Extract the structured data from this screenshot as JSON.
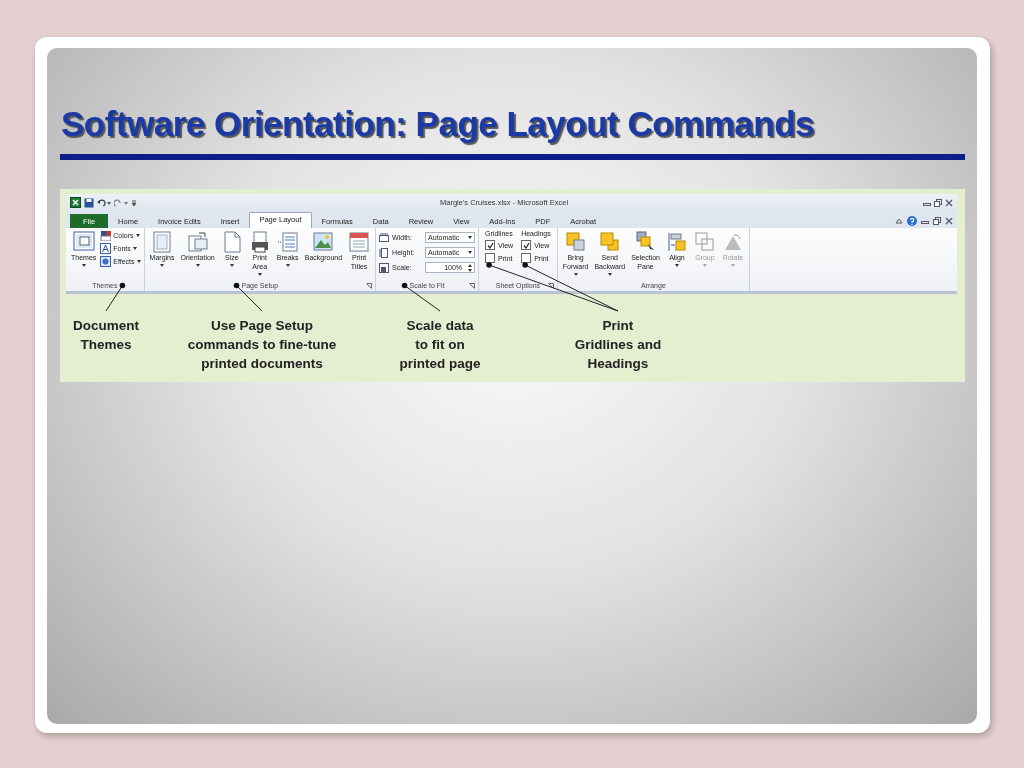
{
  "slide": {
    "title": "Software Orientation: Page Layout Commands"
  },
  "window": {
    "title": "Margie's Cruises.xlsx  -  Microsoft Excel"
  },
  "tabs": [
    {
      "label": "File",
      "selected": false,
      "kind": "file"
    },
    {
      "label": "Home",
      "selected": false,
      "kind": "tab"
    },
    {
      "label": "Invoice Edits",
      "selected": false,
      "kind": "tab"
    },
    {
      "label": "Insert",
      "selected": false,
      "kind": "tab"
    },
    {
      "label": "Page Layout",
      "selected": true,
      "kind": "tab"
    },
    {
      "label": "Formulas",
      "selected": false,
      "kind": "tab"
    },
    {
      "label": "Data",
      "selected": false,
      "kind": "tab"
    },
    {
      "label": "Review",
      "selected": false,
      "kind": "tab"
    },
    {
      "label": "View",
      "selected": false,
      "kind": "tab"
    },
    {
      "label": "Add-Ins",
      "selected": false,
      "kind": "tab"
    },
    {
      "label": "PDF",
      "selected": false,
      "kind": "tab"
    },
    {
      "label": "Acrobat",
      "selected": false,
      "kind": "tab"
    }
  ],
  "groups": [
    {
      "kind": "commands",
      "label": "Themes",
      "launcher": false,
      "commands": [
        {
          "kind": "large",
          "label": "Themes",
          "dropdown": true,
          "disabled": false
        },
        {
          "kind": "small",
          "label": "Colors",
          "dropdown": true,
          "disabled": false
        },
        {
          "kind": "small",
          "label": "Fonts",
          "dropdown": true,
          "disabled": false
        },
        {
          "kind": "small",
          "label": "Effects",
          "dropdown": true,
          "disabled": false
        }
      ]
    },
    {
      "kind": "commands",
      "label": "Page Setup",
      "launcher": true,
      "commands": [
        {
          "kind": "large",
          "label": "Margins",
          "dropdown": true,
          "disabled": false
        },
        {
          "kind": "large",
          "label": "Orientation",
          "dropdown": true,
          "disabled": false
        },
        {
          "kind": "large",
          "label": "Size",
          "dropdown": true,
          "disabled": false
        },
        {
          "kind": "large",
          "label": "Print Area",
          "dropdown": true,
          "disabled": false
        },
        {
          "kind": "large",
          "label": "Breaks",
          "dropdown": true,
          "disabled": false
        },
        {
          "kind": "large",
          "label": "Background",
          "dropdown": false,
          "disabled": false
        },
        {
          "kind": "large",
          "label": "Print Titles",
          "dropdown": false,
          "disabled": false
        }
      ]
    },
    {
      "kind": "fields",
      "label": "Scale to Fit",
      "launcher": true,
      "fields": [
        {
          "label": "Width:",
          "value": "Automatic",
          "kind": "dropdown"
        },
        {
          "label": "Height:",
          "value": "Automatic",
          "kind": "dropdown"
        },
        {
          "label": "Scale:",
          "value": "100%",
          "kind": "spinner"
        }
      ]
    },
    {
      "kind": "options",
      "label": "Sheet Options",
      "launcher": true,
      "columns": [
        {
          "heading": "Gridlines",
          "options": [
            {
              "label": "View",
              "checked": true
            },
            {
              "label": "Print",
              "checked": false
            }
          ]
        },
        {
          "heading": "Headings",
          "options": [
            {
              "label": "View",
              "checked": true
            },
            {
              "label": "Print",
              "checked": false
            }
          ]
        }
      ]
    },
    {
      "kind": "commands",
      "label": "Arrange",
      "launcher": false,
      "commands": [
        {
          "kind": "large",
          "label": "Bring Forward",
          "dropdown": true,
          "disabled": false
        },
        {
          "kind": "large",
          "label": "Send Backward",
          "dropdown": true,
          "disabled": false
        },
        {
          "kind": "large",
          "label": "Selection Pane",
          "dropdown": false,
          "disabled": false
        },
        {
          "kind": "large",
          "label": "Align",
          "dropdown": true,
          "disabled": false
        },
        {
          "kind": "large",
          "label": "Group",
          "dropdown": true,
          "disabled": true
        },
        {
          "kind": "large",
          "label": "Rotate",
          "dropdown": true,
          "disabled": true
        }
      ]
    }
  ],
  "callouts": [
    {
      "text": "Document\nThemes"
    },
    {
      "text": "Use Page Setup\ncommands to fine-tune\nprinted documents"
    },
    {
      "text": "Scale data\nto fit on\nprinted page"
    },
    {
      "text": "Print\nGridlines and\nHeadings"
    }
  ]
}
